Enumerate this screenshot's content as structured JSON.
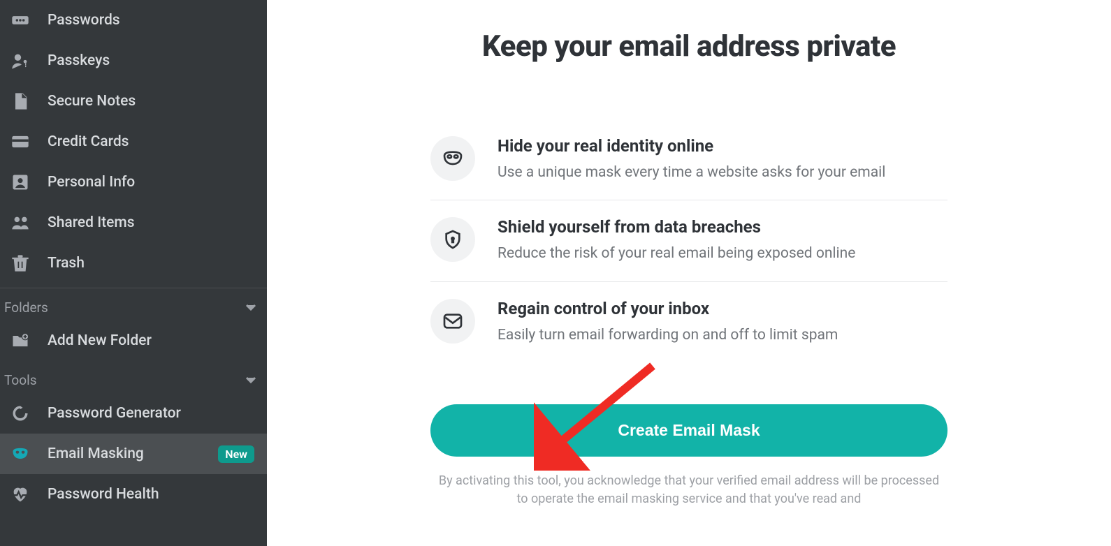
{
  "sidebar": {
    "items": [
      {
        "label": "Passwords"
      },
      {
        "label": "Passkeys"
      },
      {
        "label": "Secure Notes"
      },
      {
        "label": "Credit Cards"
      },
      {
        "label": "Personal Info"
      },
      {
        "label": "Shared Items"
      },
      {
        "label": "Trash"
      }
    ],
    "folders_header": "Folders",
    "add_folder_label": "Add New Folder",
    "tools_header": "Tools",
    "tools": [
      {
        "label": "Password Generator"
      },
      {
        "label": "Email Masking",
        "badge": "New",
        "active": true
      },
      {
        "label": "Password Health"
      }
    ]
  },
  "main": {
    "title": "Keep your email address private",
    "features": [
      {
        "heading": "Hide your real identity online",
        "desc": "Use a unique mask every time a website asks for your email"
      },
      {
        "heading": "Shield yourself from data breaches",
        "desc": "Reduce the risk of your real email being exposed online"
      },
      {
        "heading": "Regain control of your inbox",
        "desc": "Easily turn email forwarding on and off to limit spam"
      }
    ],
    "cta_label": "Create Email Mask",
    "disclaimer": "By activating this tool, you acknowledge that your verified email address will be processed to operate the email masking service and that you've read and"
  },
  "colors": {
    "accent": "#12b3a8",
    "sidebar_bg": "#34383b"
  }
}
